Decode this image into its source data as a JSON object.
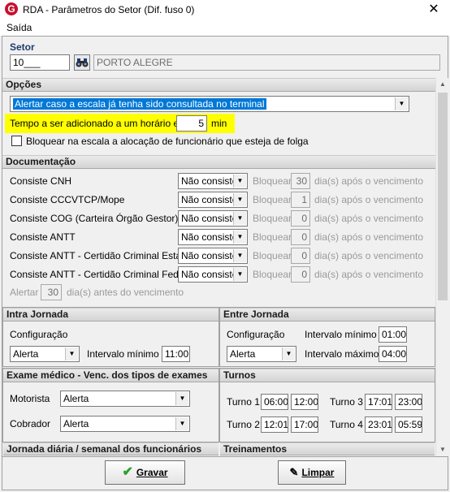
{
  "window": {
    "title": "RDA - Parâmetros do Setor (Dif. fuso 0)",
    "app_icon": "G",
    "close": "✕"
  },
  "menu": {
    "items": [
      "Saída"
    ]
  },
  "setor": {
    "label": "Setor",
    "code": "10___",
    "name": "PORTO ALEGRE"
  },
  "opcoes": {
    "title": "Opções",
    "alert_select": "Alertar caso a escala já tenha sido consultada no terminal",
    "tempo_label": "Tempo a ser adicionado a um horário extra",
    "tempo_value": "5",
    "tempo_unit": "min",
    "bloquear_label": "Bloquear na escala a alocação de funcionário que esteja de folga"
  },
  "documentacao": {
    "title": "Documentação",
    "block_label": "Bloquear",
    "after_label": "dia(s) após o vencimento",
    "rows": [
      {
        "label": "Consiste CNH",
        "option": "Não consiste",
        "days": "30"
      },
      {
        "label": "Consiste CCCVTCP/Mope",
        "option": "Não consiste",
        "days": "1"
      },
      {
        "label": "Consiste COG (Carteira Órgão Gestor)",
        "option": "Não consiste",
        "days": "0"
      },
      {
        "label": "Consiste ANTT",
        "option": "Não consiste",
        "days": "0"
      },
      {
        "label": "Consiste ANTT - Certidão Criminal Estadual",
        "option": "Não consiste",
        "days": "0"
      },
      {
        "label": "Consiste ANTT - Certidão Criminal Federal",
        "option": "Não consiste",
        "days": "0"
      }
    ],
    "alertar_label": "Alertar",
    "alertar_days": "30",
    "alertar_suffix": "dia(s) antes do vencimento"
  },
  "intra": {
    "title": "Intra Jornada",
    "config_label": "Configuração",
    "config_value": "Alerta",
    "interval_label": "Intervalo mínimo",
    "interval_value": "11:00"
  },
  "entre": {
    "title": "Entre Jornada",
    "config_label": "Configuração",
    "config_value": "Alerta",
    "min_label": "Intervalo mínimo",
    "min_value": "01:00",
    "max_label": "Intervalo máximo",
    "max_value": "04:00"
  },
  "exame": {
    "title": "Exame médico - Venc. dos tipos de exames",
    "motorista_label": "Motorista",
    "motorista_value": "Alerta",
    "cobrador_label": "Cobrador",
    "cobrador_value": "Alerta"
  },
  "turnos": {
    "title": "Turnos",
    "items": [
      {
        "label": "Turno 1",
        "start": "06:00",
        "end": "12:00"
      },
      {
        "label": "Turno 2",
        "start": "12:01",
        "end": "17:00"
      },
      {
        "label": "Turno 3",
        "start": "17:01",
        "end": "23:00"
      },
      {
        "label": "Turno 4",
        "start": "23:01",
        "end": "05:59"
      }
    ]
  },
  "jornada": {
    "title": "Jornada diária / semanal dos funcionários"
  },
  "treinamentos": {
    "title": "Treinamentos"
  },
  "actions": {
    "save": "Gravar",
    "clear": "Limpar"
  },
  "colors": {
    "brand": "#c8102e",
    "highlight": "#ffff00",
    "selection": "#0078d7",
    "save_icon": "#2e9e2e"
  }
}
